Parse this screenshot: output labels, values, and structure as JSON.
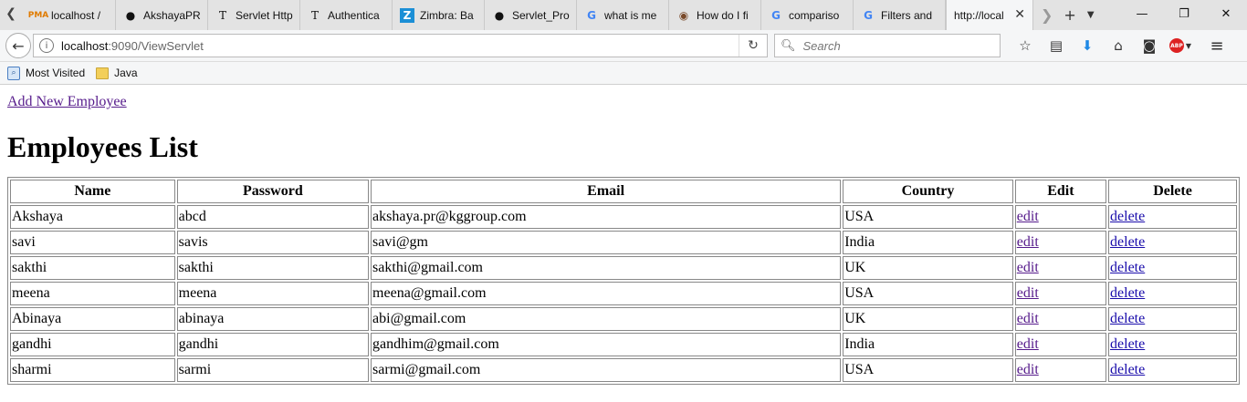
{
  "browser": {
    "tabs": [
      {
        "title": "localhost /",
        "icon": "phpmyadmin-icon"
      },
      {
        "title": "AkshayaPR",
        "icon": "github-icon"
      },
      {
        "title": "Servlet Http",
        "icon": "tutorial-icon"
      },
      {
        "title": "Authentica",
        "icon": "tutorial-icon"
      },
      {
        "title": "Zimbra: Ba",
        "icon": "zimbra-icon"
      },
      {
        "title": "Servlet_Pro",
        "icon": "github-icon"
      },
      {
        "title": "what is me",
        "icon": "google-icon"
      },
      {
        "title": "How do I fi",
        "icon": "stackoverflow-icon"
      },
      {
        "title": "compariso",
        "icon": "google-icon"
      },
      {
        "title": "Filters and",
        "icon": "google-icon"
      }
    ],
    "active_tab": {
      "title": "http://local"
    },
    "url_host": "localhost",
    "url_rest": ":9090/ViewServlet",
    "search_placeholder": "Search",
    "bookmarks": [
      {
        "label": "Most Visited"
      },
      {
        "label": "Java"
      }
    ]
  },
  "page": {
    "add_link": "Add New Employee",
    "heading": "Employees List",
    "table": {
      "headers": [
        "Name",
        "Password",
        "Email",
        "Country",
        "Edit",
        "Delete"
      ],
      "rows": [
        {
          "name": "Akshaya",
          "password": "abcd",
          "email": "akshaya.pr@kggroup.com",
          "country": "USA",
          "edit": "edit",
          "delete": "delete"
        },
        {
          "name": "savi",
          "password": "savis",
          "email": "savi@gm",
          "country": "India",
          "edit": "edit",
          "delete": "delete"
        },
        {
          "name": "sakthi",
          "password": "sakthi",
          "email": "sakthi@gmail.com",
          "country": "UK",
          "edit": "edit",
          "delete": "delete"
        },
        {
          "name": "meena",
          "password": "meena",
          "email": "meena@gmail.com",
          "country": "USA",
          "edit": "edit",
          "delete": "delete"
        },
        {
          "name": "Abinaya",
          "password": "abinaya",
          "email": "abi@gmail.com",
          "country": "UK",
          "edit": "edit",
          "delete": "delete"
        },
        {
          "name": "gandhi",
          "password": "gandhi",
          "email": "gandhim@gmail.com",
          "country": "India",
          "edit": "edit",
          "delete": "delete"
        },
        {
          "name": "sharmi",
          "password": "sarmi",
          "email": "sarmi@gmail.com",
          "country": "USA",
          "edit": "edit",
          "delete": "delete"
        }
      ]
    }
  }
}
